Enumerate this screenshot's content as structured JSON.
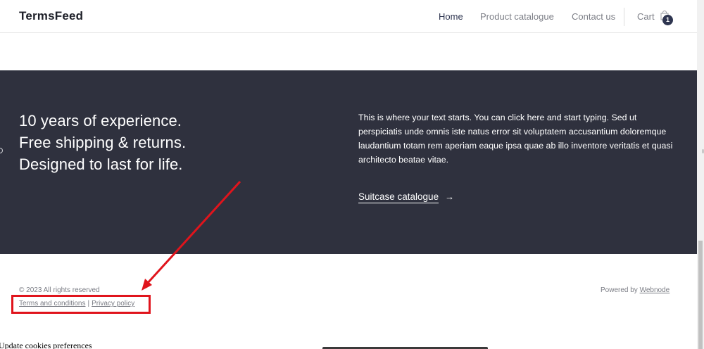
{
  "header": {
    "logo": "TermsFeed",
    "nav": [
      {
        "label": "Home",
        "active": true
      },
      {
        "label": "Product catalogue",
        "active": false
      },
      {
        "label": "Contact us",
        "active": false
      }
    ],
    "cart_label": "Cart",
    "cart_count": "1",
    "cart_icon": "shopping-bag-icon"
  },
  "hero": {
    "headline_lines": [
      "10 years of experience.",
      "Free shipping & returns.",
      "Designed to last for life."
    ],
    "body": "This is where your text starts. You can click here and start typing. Sed ut perspiciatis unde omnis iste natus error sit voluptatem accusantium doloremque laudantium totam rem aperiam eaque ipsa quae ab illo inventore veritatis et quasi architecto beatae vitae.",
    "cta_label": "Suitcase catalogue",
    "cta_arrow": "→"
  },
  "footer": {
    "copyright": "© 2023 All rights reserved",
    "terms_link": "Terms and conditions",
    "separator": "|",
    "privacy_link": "Privacy policy",
    "powered_by": "Powered by",
    "powered_by_link": "Webnode"
  },
  "cookie_link": "Update cookies preferences",
  "colors": {
    "band_background": "#2f313e",
    "annotation_red": "#e0141c",
    "nav_active": "#2e3550"
  }
}
